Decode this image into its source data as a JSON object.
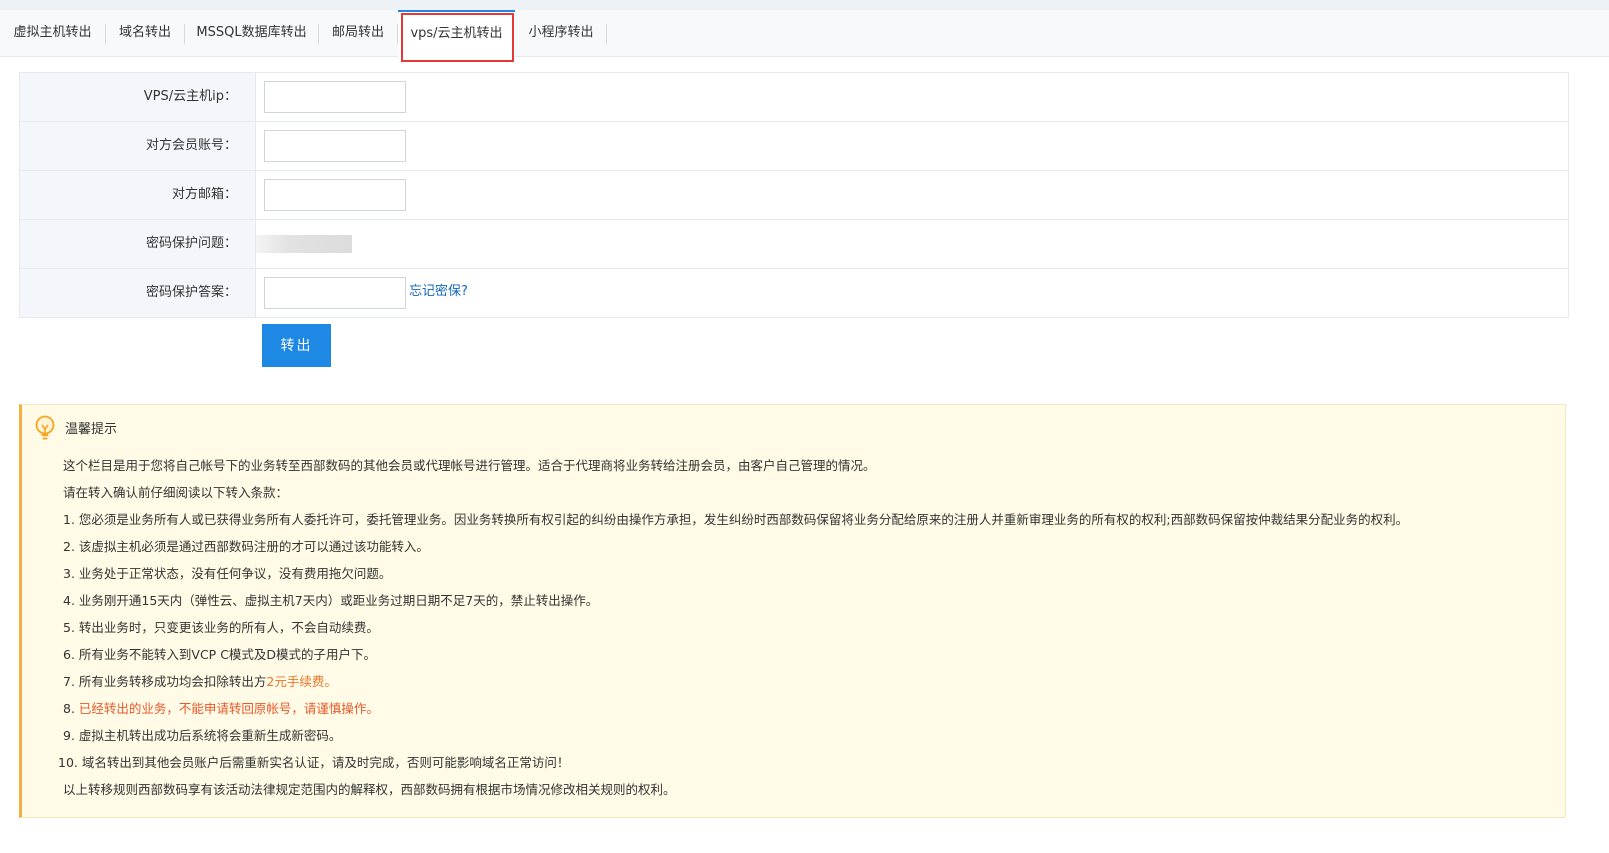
{
  "tabs": [
    {
      "label": "虚拟主机转出"
    },
    {
      "label": "域名转出"
    },
    {
      "label": "MSSQL数据库转出"
    },
    {
      "label": "邮局转出"
    },
    {
      "label": "vps/云主机转出",
      "active": true
    },
    {
      "label": "小程序转出"
    }
  ],
  "form": {
    "ip_label": "VPS/云主机ip：",
    "ip_value": "",
    "account_label": "对方会员账号：",
    "account_value": "",
    "email_label": "对方邮箱：",
    "email_value": "",
    "question_label": "密码保护问题：",
    "answer_label": "密码保护答案：",
    "answer_value": "",
    "forgot_link": "忘记密保?",
    "submit_label": "转出"
  },
  "tips": {
    "icon": "lightbulb-icon",
    "title": "温馨提示",
    "intro1": "这个栏目是用于您将自己帐号下的业务转至西部数码的其他会员或代理帐号进行管理。适合于代理商将业务转给注册会员，由客户自己管理的情况。",
    "intro2": "请在转入确认前仔细阅读以下转入条款：",
    "item1": "1. 您必须是业务所有人或已获得业务所有人委托许可，委托管理业务。因业务转换所有权引起的纠纷由操作方承担，发生纠纷时西部数码保留将业务分配给原来的注册人并重新审理业务的所有权的权利;西部数码保留按仲裁结果分配业务的权利。",
    "item2": "2. 该虚拟主机必须是通过西部数码注册的才可以通过该功能转入。",
    "item3": "3. 业务处于正常状态，没有任何争议，没有费用拖欠问题。",
    "item4": "4. 业务刚开通15天内（弹性云、虚拟主机7天内）或距业务过期日期不足7天的，禁止转出操作。",
    "item5": "5. 转出业务时，只变更该业务的所有人，不会自动续费。",
    "item6": "6. 所有业务不能转入到VCP C模式及D模式的子用户下。",
    "item7_prefix": "7. 所有业务转移成功均会扣除转出方",
    "item7_fee": "2元手续费。",
    "item8_num": "8. ",
    "item8_text": "已经转出的业务，不能申请转回原帐号，请谨慎操作。",
    "item9": "9. 虚拟主机转出成功后系统将会重新生成新密码。",
    "item10": "10. 域名转出到其他会员账户后需重新实名认证，请及时完成，否则可能影响域名正常访问！",
    "outro": "以上转移规则西部数码享有该活动法律规定范围内的解释权，西部数码拥有根据市场情况修改相关规则的权利。"
  },
  "colors": {
    "accent": "#1e88e5",
    "highlight_box": "#e53935",
    "fee_orange": "#e8762b",
    "warning_red": "#e8592b"
  }
}
